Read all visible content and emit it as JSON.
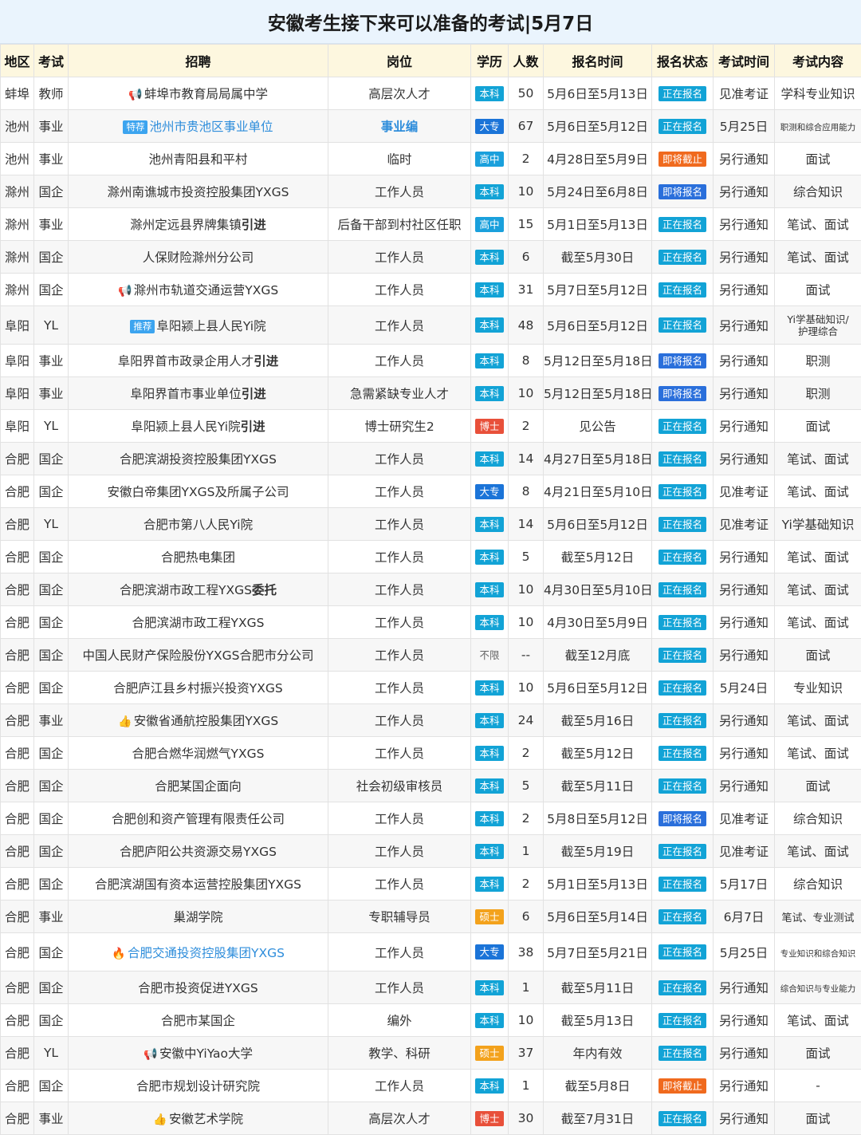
{
  "title": "安徽考生接下来可以准备的考试|5月7日",
  "headers": [
    "地区",
    "考试",
    "招聘",
    "岗位",
    "学历",
    "人数",
    "报名时间",
    "报名状态",
    "考试时间",
    "考试内容"
  ],
  "colors": {
    "本科": "#12a3d6",
    "大专": "#1b74d8",
    "高中": "#1aa0dc",
    "博士": "#e8503a",
    "硕士": "#f3a21c",
    "正在报名": "#12a3d6",
    "即将报名": "#2a6fdb",
    "即将截止": "#f06a1e"
  },
  "rows": [
    {
      "region": "蚌埠",
      "type": "教师",
      "icon": "megaphone-icon",
      "recruit": "蚌埠市教育局局属中学",
      "post": "高层次人才",
      "edu": "本科",
      "num": "50",
      "time": "5月6日至5月13日",
      "status": "正在报名",
      "exam": "见准考证",
      "content": "学科专业知识"
    },
    {
      "region": "池州",
      "type": "事业",
      "tag": "特荐",
      "recruit": "池州市贵池区事业单位",
      "recruit_style": "blue",
      "post": "事业编",
      "post_style": "blue bold",
      "edu": "大专",
      "num": "67",
      "time": "5月6日至5月12日",
      "status": "正在报名",
      "exam": "5月25日",
      "content": "职测和综合应用能力",
      "content_small": true
    },
    {
      "region": "池州",
      "type": "事业",
      "recruit": "池州青阳县和平村",
      "post": "临时",
      "edu": "高中",
      "num": "2",
      "time": "4月28日至5月9日",
      "status": "即将截止",
      "exam": "另行通知",
      "content": "面试"
    },
    {
      "region": "滁州",
      "type": "国企",
      "recruit": "滁州南谯城市投资控股集团YXGS",
      "post": "工作人员",
      "edu": "本科",
      "num": "10",
      "time": "5月24日至6月8日",
      "status": "即将报名",
      "exam": "另行通知",
      "content": "综合知识"
    },
    {
      "region": "滁州",
      "type": "事业",
      "recruit": "滁州定远县界牌集镇",
      "recruit_bold": "引进",
      "post": "后备干部到村社区任职",
      "edu": "高中",
      "num": "15",
      "time": "5月1日至5月13日",
      "status": "正在报名",
      "exam": "另行通知",
      "content": "笔试、面试"
    },
    {
      "region": "滁州",
      "type": "国企",
      "recruit": "人保财险滁州分公司",
      "post": "工作人员",
      "edu": "本科",
      "num": "6",
      "time": "截至5月30日",
      "status": "正在报名",
      "exam": "另行通知",
      "content": "笔试、面试"
    },
    {
      "region": "滁州",
      "type": "国企",
      "icon": "megaphone-icon",
      "recruit": "滁州市轨道交通运营YXGS",
      "post": "工作人员",
      "edu": "本科",
      "num": "31",
      "time": "5月7日至5月12日",
      "status": "正在报名",
      "exam": "另行通知",
      "content": "面试"
    },
    {
      "region": "阜阳",
      "type": "YL",
      "tag": "推荐",
      "recruit": "阜阳颍上县人民Yi院",
      "post": "工作人员",
      "edu": "本科",
      "num": "48",
      "time": "5月6日至5月12日",
      "status": "正在报名",
      "exam": "另行通知",
      "content": "Yi学基础知识/",
      "content2": "护理综合",
      "tall": true
    },
    {
      "region": "阜阳",
      "type": "事业",
      "recruit": "阜阳界首市政录企用人才",
      "recruit_bold": "引进",
      "post": "工作人员",
      "edu": "本科",
      "num": "8",
      "time": "5月12日至5月18日",
      "status": "即将报名",
      "exam": "另行通知",
      "content": "职测"
    },
    {
      "region": "阜阳",
      "type": "事业",
      "recruit": "阜阳界首市事业单位",
      "recruit_bold": "引进",
      "post": "急需紧缺专业人才",
      "edu": "本科",
      "num": "10",
      "time": "5月12日至5月18日",
      "status": "即将报名",
      "exam": "另行通知",
      "content": "职测"
    },
    {
      "region": "阜阳",
      "type": "YL",
      "recruit": "阜阳颍上县人民Yi院",
      "recruit_bold": "引进",
      "post": "博士研究生2",
      "edu": "博士",
      "num": "2",
      "time": "见公告",
      "status": "正在报名",
      "exam": "另行通知",
      "content": "面试"
    },
    {
      "region": "合肥",
      "type": "国企",
      "recruit": "合肥滨湖投资控股集团YXGS",
      "post": "工作人员",
      "edu": "本科",
      "num": "14",
      "time": "4月27日至5月18日",
      "status": "正在报名",
      "exam": "另行通知",
      "content": "笔试、面试"
    },
    {
      "region": "合肥",
      "type": "国企",
      "recruit": "安徽白帝集团YXGS及所属子公司",
      "post": "工作人员",
      "edu": "大专",
      "num": "8",
      "time": "4月21日至5月10日",
      "status": "正在报名",
      "exam": "见准考证",
      "content": "笔试、面试"
    },
    {
      "region": "合肥",
      "type": "YL",
      "recruit": "合肥市第八人民Yi院",
      "post": "工作人员",
      "edu": "本科",
      "num": "14",
      "time": "5月6日至5月12日",
      "status": "正在报名",
      "exam": "见准考证",
      "content": "Yi学基础知识"
    },
    {
      "region": "合肥",
      "type": "国企",
      "recruit": "合肥热电集团",
      "post": "工作人员",
      "edu": "本科",
      "num": "5",
      "time": "截至5月12日",
      "status": "正在报名",
      "exam": "另行通知",
      "content": "笔试、面试"
    },
    {
      "region": "合肥",
      "type": "国企",
      "recruit": "合肥滨湖市政工程YXGS",
      "recruit_bold": "委托",
      "post": "工作人员",
      "edu": "本科",
      "num": "10",
      "time": "4月30日至5月10日",
      "status": "正在报名",
      "exam": "另行通知",
      "content": "笔试、面试"
    },
    {
      "region": "合肥",
      "type": "国企",
      "recruit": "合肥滨湖市政工程YXGS",
      "post": "工作人员",
      "edu": "本科",
      "num": "10",
      "time": "4月30日至5月9日",
      "status": "正在报名",
      "exam": "另行通知",
      "content": "笔试、面试"
    },
    {
      "region": "合肥",
      "type": "国企",
      "recruit": "中国人民财产保险股份YXGS合肥市分公司",
      "post": "工作人员",
      "edu": "不限",
      "num": "--",
      "time": "截至12月底",
      "status": "正在报名",
      "exam": "另行通知",
      "content": "面试"
    },
    {
      "region": "合肥",
      "type": "国企",
      "recruit": "合肥庐江县乡村振兴投资YXGS",
      "post": "工作人员",
      "edu": "本科",
      "num": "10",
      "time": "5月6日至5月12日",
      "status": "正在报名",
      "exam": "5月24日",
      "content": "专业知识"
    },
    {
      "region": "合肥",
      "type": "事业",
      "icon": "thumbs-up-icon",
      "recruit": "安徽省通航控股集团YXGS",
      "post": "工作人员",
      "edu": "本科",
      "num": "24",
      "time": "截至5月16日",
      "status": "正在报名",
      "exam": "另行通知",
      "content": "笔试、面试"
    },
    {
      "region": "合肥",
      "type": "国企",
      "recruit": "合肥合燃华润燃气YXGS",
      "post": "工作人员",
      "edu": "本科",
      "num": "2",
      "time": "截至5月12日",
      "status": "正在报名",
      "exam": "另行通知",
      "content": "笔试、面试"
    },
    {
      "region": "合肥",
      "type": "国企",
      "recruit": "合肥某国企面向",
      "post": "社会初级审核员",
      "edu": "本科",
      "num": "5",
      "time": "截至5月11日",
      "status": "正在报名",
      "exam": "另行通知",
      "content": "面试"
    },
    {
      "region": "合肥",
      "type": "国企",
      "recruit": "合肥创和资产管理有限责任公司",
      "post": "工作人员",
      "edu": "本科",
      "num": "2",
      "time": "5月8日至5月12日",
      "status": "即将报名",
      "exam": "见准考证",
      "content": "综合知识"
    },
    {
      "region": "合肥",
      "type": "国企",
      "recruit": "合肥庐阳公共资源交易YXGS",
      "post": "工作人员",
      "edu": "本科",
      "num": "1",
      "time": "截至5月19日",
      "status": "正在报名",
      "exam": "见准考证",
      "content": "笔试、面试"
    },
    {
      "region": "合肥",
      "type": "国企",
      "recruit": "合肥滨湖国有资本运营控股集团YXGS",
      "post": "工作人员",
      "edu": "本科",
      "num": "2",
      "time": "5月1日至5月13日",
      "status": "正在报名",
      "exam": "5月17日",
      "content": "综合知识"
    },
    {
      "region": "合肥",
      "type": "事业",
      "recruit": "巢湖学院",
      "post": "专职辅导员",
      "edu": "硕士",
      "num": "6",
      "time": "5月6日至5月14日",
      "status": "正在报名",
      "exam": "6月7日",
      "content": "笔试、专业测试",
      "content_mid": true
    },
    {
      "region": "合肥",
      "type": "国企",
      "icon": "fire-icon",
      "recruit": "合肥交通投资控股集团YXGS",
      "recruit_style": "blue",
      "post": "工作人员",
      "edu": "大专",
      "num": "38",
      "time": "5月7日至5月21日",
      "status": "正在报名",
      "exam": "5月25日",
      "content": "专业知识和综合知识",
      "content_small": true,
      "tall": true
    },
    {
      "region": "合肥",
      "type": "国企",
      "recruit": "合肥市投资促进YXGS",
      "post": "工作人员",
      "edu": "本科",
      "num": "1",
      "time": "截至5月11日",
      "status": "正在报名",
      "exam": "另行通知",
      "content": "综合知识与专业能力",
      "content_small": true
    },
    {
      "region": "合肥",
      "type": "国企",
      "recruit": "合肥市某国企",
      "post": "编外",
      "edu": "本科",
      "num": "10",
      "time": "截至5月13日",
      "status": "正在报名",
      "exam": "另行通知",
      "content": "笔试、面试"
    },
    {
      "region": "合肥",
      "type": "YL",
      "icon": "megaphone-icon",
      "recruit": "安徽中YiYao大学",
      "post": "教学、科研",
      "edu": "硕士",
      "num": "37",
      "time": "年内有效",
      "status": "正在报名",
      "exam": "另行通知",
      "content": "面试"
    },
    {
      "region": "合肥",
      "type": "国企",
      "recruit": "合肥市规划设计研究院",
      "post": "工作人员",
      "edu": "本科",
      "num": "1",
      "time": "截至5月8日",
      "status": "即将截止",
      "exam": "另行通知",
      "content": "-"
    },
    {
      "region": "合肥",
      "type": "事业",
      "icon": "thumbs-up-icon",
      "recruit": "安徽艺术学院",
      "post": "高层次人才",
      "edu": "博士",
      "num": "30",
      "time": "截至7月31日",
      "status": "正在报名",
      "exam": "另行通知",
      "content": "面试"
    }
  ]
}
